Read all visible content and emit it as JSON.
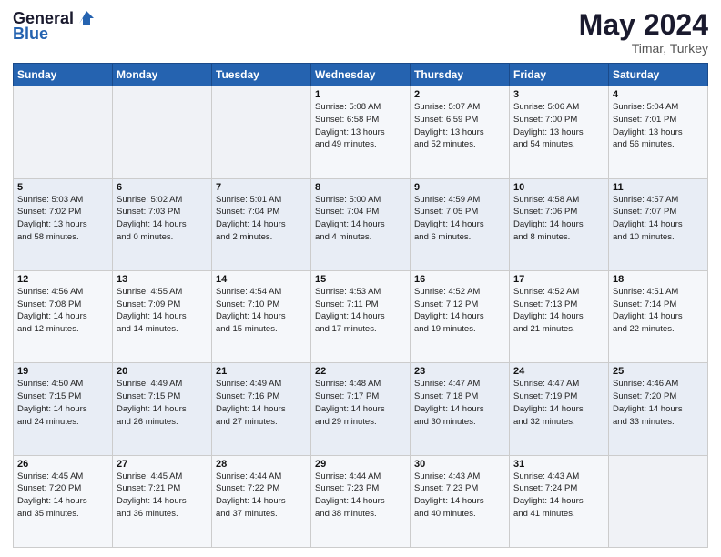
{
  "header": {
    "logo_line1": "General",
    "logo_line2": "Blue",
    "title": "May 2024",
    "subtitle": "Timar, Turkey"
  },
  "days_of_week": [
    "Sunday",
    "Monday",
    "Tuesday",
    "Wednesday",
    "Thursday",
    "Friday",
    "Saturday"
  ],
  "weeks": [
    [
      {
        "day": "",
        "info": ""
      },
      {
        "day": "",
        "info": ""
      },
      {
        "day": "",
        "info": ""
      },
      {
        "day": "1",
        "info": "Sunrise: 5:08 AM\nSunset: 6:58 PM\nDaylight: 13 hours\nand 49 minutes."
      },
      {
        "day": "2",
        "info": "Sunrise: 5:07 AM\nSunset: 6:59 PM\nDaylight: 13 hours\nand 52 minutes."
      },
      {
        "day": "3",
        "info": "Sunrise: 5:06 AM\nSunset: 7:00 PM\nDaylight: 13 hours\nand 54 minutes."
      },
      {
        "day": "4",
        "info": "Sunrise: 5:04 AM\nSunset: 7:01 PM\nDaylight: 13 hours\nand 56 minutes."
      }
    ],
    [
      {
        "day": "5",
        "info": "Sunrise: 5:03 AM\nSunset: 7:02 PM\nDaylight: 13 hours\nand 58 minutes."
      },
      {
        "day": "6",
        "info": "Sunrise: 5:02 AM\nSunset: 7:03 PM\nDaylight: 14 hours\nand 0 minutes."
      },
      {
        "day": "7",
        "info": "Sunrise: 5:01 AM\nSunset: 7:04 PM\nDaylight: 14 hours\nand 2 minutes."
      },
      {
        "day": "8",
        "info": "Sunrise: 5:00 AM\nSunset: 7:04 PM\nDaylight: 14 hours\nand 4 minutes."
      },
      {
        "day": "9",
        "info": "Sunrise: 4:59 AM\nSunset: 7:05 PM\nDaylight: 14 hours\nand 6 minutes."
      },
      {
        "day": "10",
        "info": "Sunrise: 4:58 AM\nSunset: 7:06 PM\nDaylight: 14 hours\nand 8 minutes."
      },
      {
        "day": "11",
        "info": "Sunrise: 4:57 AM\nSunset: 7:07 PM\nDaylight: 14 hours\nand 10 minutes."
      }
    ],
    [
      {
        "day": "12",
        "info": "Sunrise: 4:56 AM\nSunset: 7:08 PM\nDaylight: 14 hours\nand 12 minutes."
      },
      {
        "day": "13",
        "info": "Sunrise: 4:55 AM\nSunset: 7:09 PM\nDaylight: 14 hours\nand 14 minutes."
      },
      {
        "day": "14",
        "info": "Sunrise: 4:54 AM\nSunset: 7:10 PM\nDaylight: 14 hours\nand 15 minutes."
      },
      {
        "day": "15",
        "info": "Sunrise: 4:53 AM\nSunset: 7:11 PM\nDaylight: 14 hours\nand 17 minutes."
      },
      {
        "day": "16",
        "info": "Sunrise: 4:52 AM\nSunset: 7:12 PM\nDaylight: 14 hours\nand 19 minutes."
      },
      {
        "day": "17",
        "info": "Sunrise: 4:52 AM\nSunset: 7:13 PM\nDaylight: 14 hours\nand 21 minutes."
      },
      {
        "day": "18",
        "info": "Sunrise: 4:51 AM\nSunset: 7:14 PM\nDaylight: 14 hours\nand 22 minutes."
      }
    ],
    [
      {
        "day": "19",
        "info": "Sunrise: 4:50 AM\nSunset: 7:15 PM\nDaylight: 14 hours\nand 24 minutes."
      },
      {
        "day": "20",
        "info": "Sunrise: 4:49 AM\nSunset: 7:15 PM\nDaylight: 14 hours\nand 26 minutes."
      },
      {
        "day": "21",
        "info": "Sunrise: 4:49 AM\nSunset: 7:16 PM\nDaylight: 14 hours\nand 27 minutes."
      },
      {
        "day": "22",
        "info": "Sunrise: 4:48 AM\nSunset: 7:17 PM\nDaylight: 14 hours\nand 29 minutes."
      },
      {
        "day": "23",
        "info": "Sunrise: 4:47 AM\nSunset: 7:18 PM\nDaylight: 14 hours\nand 30 minutes."
      },
      {
        "day": "24",
        "info": "Sunrise: 4:47 AM\nSunset: 7:19 PM\nDaylight: 14 hours\nand 32 minutes."
      },
      {
        "day": "25",
        "info": "Sunrise: 4:46 AM\nSunset: 7:20 PM\nDaylight: 14 hours\nand 33 minutes."
      }
    ],
    [
      {
        "day": "26",
        "info": "Sunrise: 4:45 AM\nSunset: 7:20 PM\nDaylight: 14 hours\nand 35 minutes."
      },
      {
        "day": "27",
        "info": "Sunrise: 4:45 AM\nSunset: 7:21 PM\nDaylight: 14 hours\nand 36 minutes."
      },
      {
        "day": "28",
        "info": "Sunrise: 4:44 AM\nSunset: 7:22 PM\nDaylight: 14 hours\nand 37 minutes."
      },
      {
        "day": "29",
        "info": "Sunrise: 4:44 AM\nSunset: 7:23 PM\nDaylight: 14 hours\nand 38 minutes."
      },
      {
        "day": "30",
        "info": "Sunrise: 4:43 AM\nSunset: 7:23 PM\nDaylight: 14 hours\nand 40 minutes."
      },
      {
        "day": "31",
        "info": "Sunrise: 4:43 AM\nSunset: 7:24 PM\nDaylight: 14 hours\nand 41 minutes."
      },
      {
        "day": "",
        "info": ""
      }
    ]
  ]
}
